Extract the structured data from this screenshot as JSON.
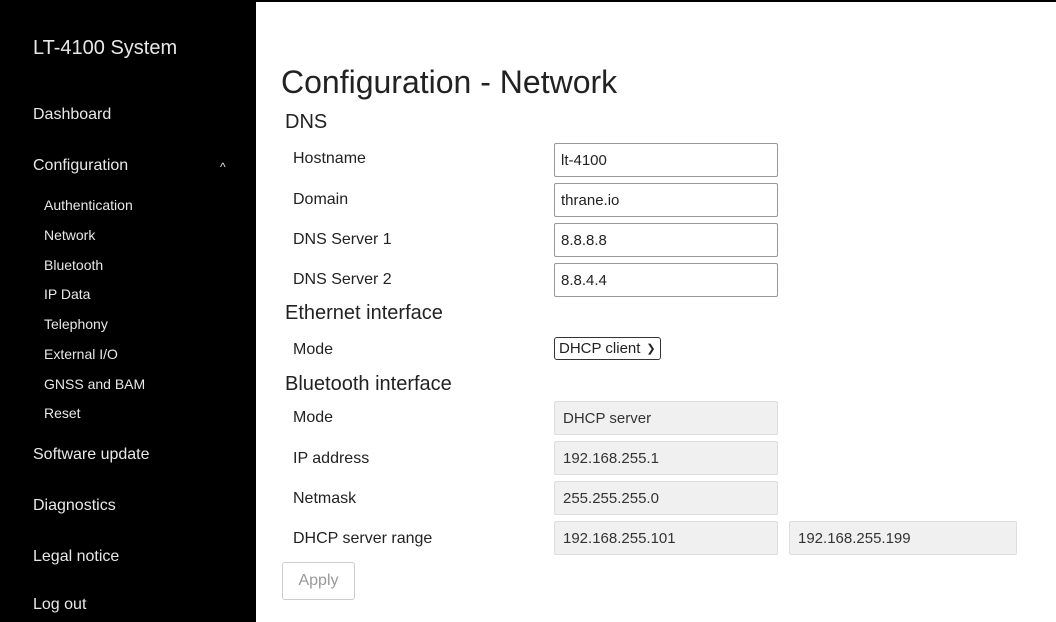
{
  "sidebar": {
    "brand": "LT-4100 System",
    "items": [
      {
        "label": "Dashboard"
      },
      {
        "label": "Configuration",
        "expanded": true
      },
      {
        "label": "Software update"
      },
      {
        "label": "Diagnostics"
      },
      {
        "label": "Legal notice"
      },
      {
        "label": "Log out"
      }
    ],
    "sub_items": [
      {
        "label": "Authentication"
      },
      {
        "label": "Network",
        "active": true
      },
      {
        "label": "Bluetooth"
      },
      {
        "label": "IP Data"
      },
      {
        "label": "Telephony"
      },
      {
        "label": "External I/O"
      },
      {
        "label": "GNSS and BAM"
      },
      {
        "label": "Reset"
      }
    ]
  },
  "main": {
    "title": "Configuration - Network",
    "dns": {
      "heading": "DNS",
      "hostname_label": "Hostname",
      "hostname_value": "lt-4100",
      "domain_label": "Domain",
      "domain_value": "thrane.io",
      "dns1_label": "DNS Server 1",
      "dns1_value": "8.8.8.8",
      "dns2_label": "DNS Server 2",
      "dns2_value": "8.8.4.4"
    },
    "ethernet": {
      "heading": "Ethernet interface",
      "mode_label": "Mode",
      "mode_value": "DHCP client"
    },
    "bluetooth": {
      "heading": "Bluetooth interface",
      "mode_label": "Mode",
      "mode_value": "DHCP server",
      "ip_label": "IP address",
      "ip_value": "192.168.255.1",
      "netmask_label": "Netmask",
      "netmask_value": "255.255.255.0",
      "range_label": "DHCP server range",
      "range_start": "192.168.255.101",
      "range_end": "192.168.255.199"
    },
    "apply_label": "Apply"
  },
  "colors": {
    "sidebar_bg": "#000000",
    "sidebar_text": "#e8e8e8",
    "readonly_bg": "#f0f0f0"
  }
}
